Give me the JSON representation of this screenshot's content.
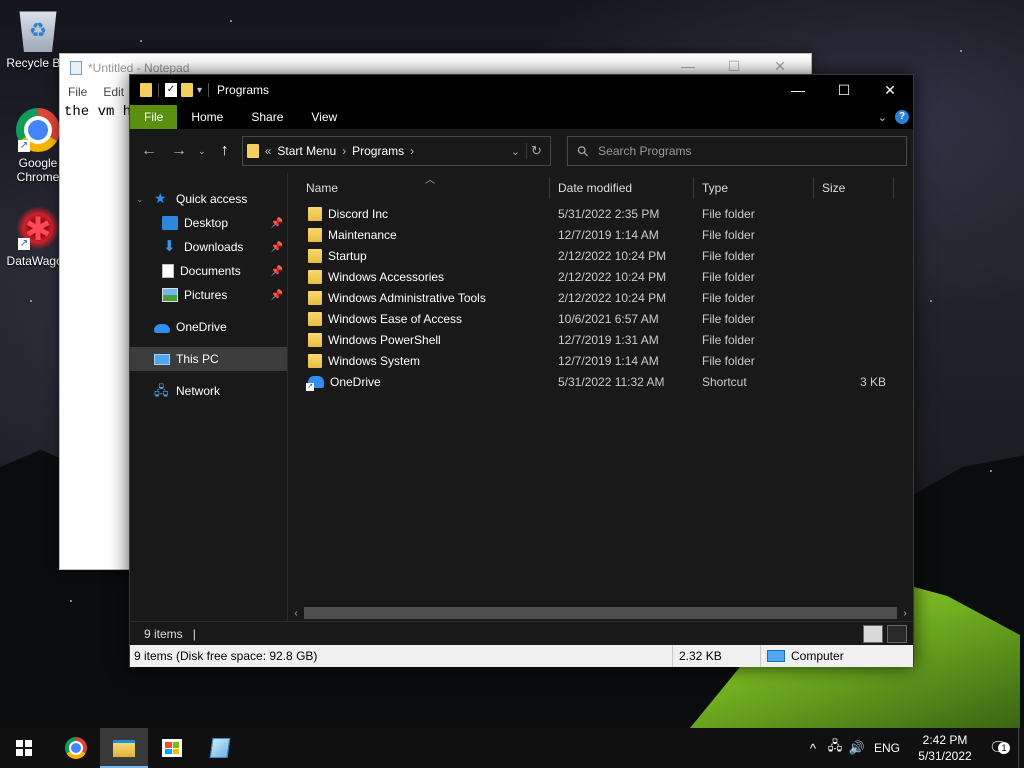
{
  "desktop": {
    "icons": [
      {
        "label": "Recycle Bin"
      },
      {
        "label": "Google Chrome"
      },
      {
        "label": "DataWagon"
      }
    ]
  },
  "notepad": {
    "title": "*Untitled - Notepad",
    "menu": [
      "File",
      "Edit"
    ],
    "text": "the vm ha"
  },
  "explorer": {
    "title": "Programs",
    "ribbon_tabs": [
      "File",
      "Home",
      "Share",
      "View"
    ],
    "address": {
      "overflow": "«",
      "crumbs": [
        "Start Menu",
        "Programs"
      ]
    },
    "search_placeholder": "Search Programs",
    "nav": {
      "quick_access": "Quick access",
      "pinned": [
        "Desktop",
        "Downloads",
        "Documents",
        "Pictures"
      ],
      "onedrive": "OneDrive",
      "this_pc": "This PC",
      "network": "Network"
    },
    "columns": [
      "Name",
      "Date modified",
      "Type",
      "Size"
    ],
    "files": [
      {
        "name": "Discord Inc",
        "date": "5/31/2022 2:35 PM",
        "type": "File folder",
        "size": "",
        "icon": "folder-icon"
      },
      {
        "name": "Maintenance",
        "date": "12/7/2019 1:14 AM",
        "type": "File folder",
        "size": "",
        "icon": "folder-icon"
      },
      {
        "name": "Startup",
        "date": "2/12/2022 10:24 PM",
        "type": "File folder",
        "size": "",
        "icon": "folder-icon"
      },
      {
        "name": "Windows Accessories",
        "date": "2/12/2022 10:24 PM",
        "type": "File folder",
        "size": "",
        "icon": "folder-icon"
      },
      {
        "name": "Windows Administrative Tools",
        "date": "2/12/2022 10:24 PM",
        "type": "File folder",
        "size": "",
        "icon": "folder-icon"
      },
      {
        "name": "Windows Ease of Access",
        "date": "10/6/2021 6:57 AM",
        "type": "File folder",
        "size": "",
        "icon": "folder-icon"
      },
      {
        "name": "Windows PowerShell",
        "date": "12/7/2019 1:31 AM",
        "type": "File folder",
        "size": "",
        "icon": "folder-icon"
      },
      {
        "name": "Windows System",
        "date": "12/7/2019 1:14 AM",
        "type": "File folder",
        "size": "",
        "icon": "folder-icon"
      },
      {
        "name": "OneDrive",
        "date": "5/31/2022 11:32 AM",
        "type": "Shortcut",
        "size": "3 KB",
        "icon": "onedrive-shortcut-icon"
      }
    ],
    "status_count": "9 items",
    "details_bar": {
      "summary": "9 items (Disk free space: 92.8 GB)",
      "size": "2.32 KB",
      "location": "Computer"
    }
  },
  "taskbar": {
    "language": "ENG",
    "time": "2:42 PM",
    "date": "5/31/2022",
    "notification_count": "1"
  },
  "colors": {
    "ribbon_file_tab": "#5a8f0f",
    "accent_blue": "#2f8ef0",
    "folder_yellow": "#f3cf5d"
  }
}
